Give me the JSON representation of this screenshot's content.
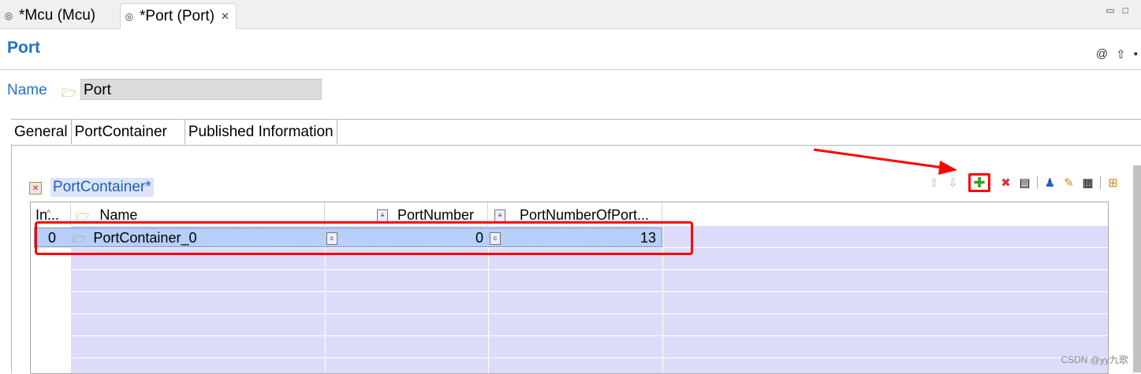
{
  "editor_tabs": [
    {
      "label": "*Mcu (Mcu)",
      "active": false
    },
    {
      "label": "*Port (Port)",
      "active": true,
      "close": "✕"
    }
  ],
  "window_controls": {
    "minimize": "▭",
    "maximize": "□"
  },
  "page": {
    "title": "Port"
  },
  "name_row": {
    "label": "Name",
    "value": "Port"
  },
  "param_tabs": [
    "General",
    "PortContainer",
    "Published Information"
  ],
  "active_param_tab": "PortContainer",
  "container": {
    "title": "PortContainer*"
  },
  "table": {
    "columns": [
      "In...",
      "Name",
      "PortNumber",
      "PortNumberOfPort..."
    ],
    "rows": [
      {
        "index": "0",
        "name": "PortContainer_0",
        "port_number": "0",
        "port_number_of_port": "13"
      }
    ]
  },
  "watermark": "CSDN @yy九歌",
  "colors": {
    "accent": "#1f73c2",
    "selection": "#b6cffb",
    "lavender": "#dcdcfa",
    "annotation": "#ff0000"
  }
}
